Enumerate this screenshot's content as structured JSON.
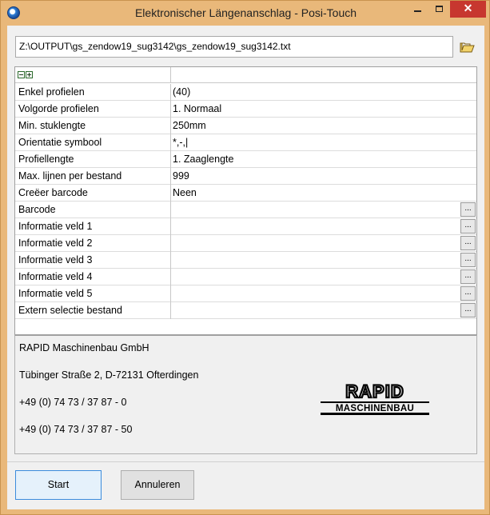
{
  "window": {
    "title": "Elektronischer Längenanschlag - Posi-Touch",
    "accent_color": "#e9b87a",
    "close_color": "#c7372f"
  },
  "path": {
    "value": "Z:\\OUTPUT\\gs_zendow19_sug3142\\gs_zendow19_sug3142.txt"
  },
  "grid": {
    "rows": [
      {
        "label": "Enkel profielen",
        "value": "(40)",
        "has_button": false
      },
      {
        "label": "Volgorde profielen",
        "value": "1. Normaal",
        "has_button": false
      },
      {
        "label": "Min. stuklengte",
        "value": "250mm",
        "has_button": false
      },
      {
        "label": "Orientatie symbool",
        "value": "*,-,|",
        "has_button": false
      },
      {
        "label": "Profiellengte",
        "value": "1. Zaaglengte",
        "has_button": false
      },
      {
        "label": "Max. lijnen per bestand",
        "value": "999",
        "has_button": false
      },
      {
        "label": "Creëer barcode",
        "value": "Neen",
        "has_button": false
      },
      {
        "label": "Barcode",
        "value": "",
        "has_button": true
      },
      {
        "label": "Informatie veld 1",
        "value": "",
        "has_button": true
      },
      {
        "label": "Informatie veld 2",
        "value": "",
        "has_button": true
      },
      {
        "label": "Informatie veld 3",
        "value": "",
        "has_button": true
      },
      {
        "label": "Informatie veld 4",
        "value": "",
        "has_button": true
      },
      {
        "label": "Informatie veld 5",
        "value": "",
        "has_button": true
      },
      {
        "label": "Extern selectie bestand",
        "value": "",
        "has_button": true
      }
    ],
    "ellipsis_label": "..."
  },
  "company": {
    "name": "RAPID Maschinenbau GmbH",
    "address": "Tübinger Straße 2, D-72131 Ofterdingen",
    "phone": "+49 (0) 74 73 / 37 87 - 0",
    "fax": "+49 (0) 74 73 / 37 87 - 50",
    "logo_top": "RAPID",
    "logo_bottom": "MASCHINENBAU"
  },
  "buttons": {
    "start": "Start",
    "cancel": "Annuleren"
  }
}
